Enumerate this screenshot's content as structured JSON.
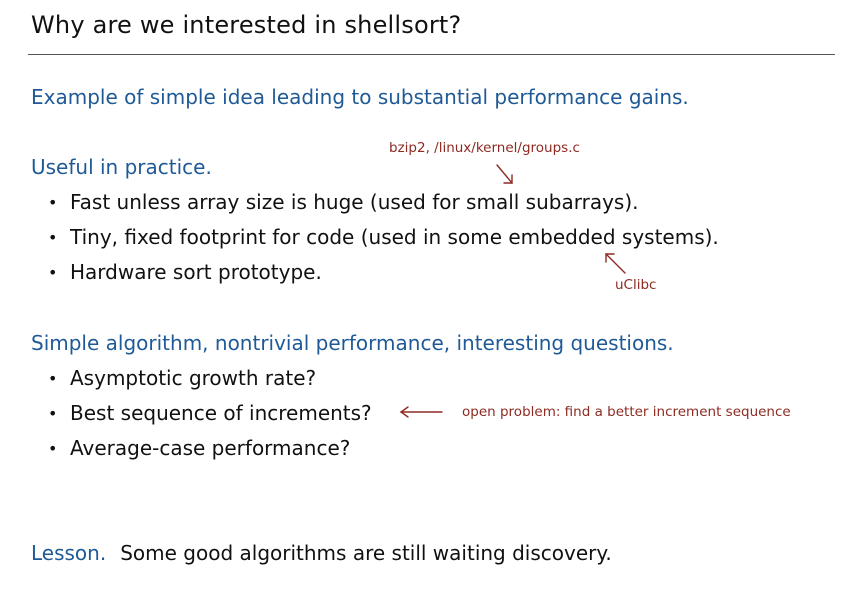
{
  "slide": {
    "title": "Why are we interested in shellsort?",
    "intro": "Example of simple idea leading to substantial performance gains.",
    "sections": [
      {
        "heading": "Useful in practice.",
        "bullets": [
          "Fast unless array size is huge (used for small subarrays).",
          "Tiny, fixed footprint for code (used in some embedded systems).",
          "Hardware sort prototype."
        ]
      },
      {
        "heading": "Simple algorithm, nontrivial performance, interesting questions.",
        "bullets": [
          "Asymptotic growth rate?",
          "Best sequence of increments?",
          "Average-case performance?"
        ]
      }
    ],
    "annotations": {
      "bzip": "bzip2, /linux/kernel/groups.c",
      "uclibc": "uClibc",
      "open_problem": "open problem:  find a better increment sequence"
    },
    "lesson": {
      "label": "Lesson.",
      "text": "Some good algorithms are still waiting discovery."
    },
    "bullet_glyph": "•",
    "colors": {
      "heading": "#1f5a96",
      "annotation": "#8e2b23",
      "text": "#111111"
    }
  }
}
